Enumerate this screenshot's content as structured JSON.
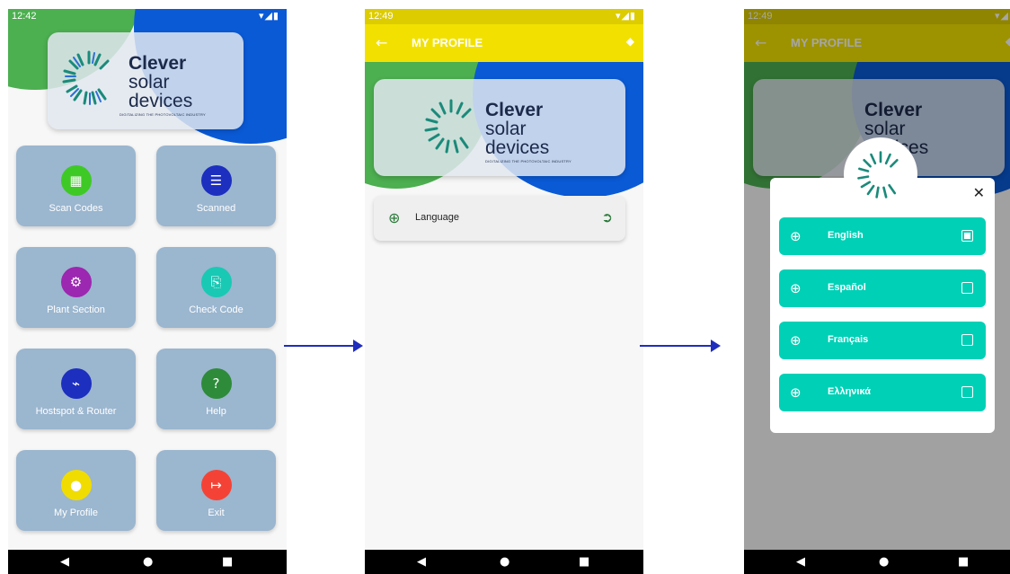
{
  "brand": {
    "line1": "Clever",
    "line2": "solar",
    "line3": "devices",
    "tagline": "DIGITALIZING THE PHOTOVOLTAIC INDUSTRY"
  },
  "colors": {
    "appbar": "#f2e100",
    "tile": "#9bb6cf",
    "accent_teal": "#00d0b6",
    "brand_green": "#4caf50",
    "brand_blue": "#0a5ad6",
    "arrow": "#1f2dbd"
  },
  "screen1": {
    "time": "12:42",
    "status_icons": "▾◢▮",
    "tiles": [
      {
        "label": "Scan Codes",
        "icon": "qr-code-icon",
        "color": "#3fc927",
        "glyph": "▦"
      },
      {
        "label": "Scanned",
        "icon": "list-icon",
        "color": "#1c2fbf",
        "glyph": "☰"
      },
      {
        "label": "Plant Section",
        "icon": "gear-icon",
        "color": "#9c27b0",
        "glyph": "⚙"
      },
      {
        "label": "Check Code",
        "icon": "clipboard-search-icon",
        "color": "#19c9b4",
        "glyph": "⎘"
      },
      {
        "label": "Hostspot & Router",
        "icon": "router-icon",
        "color": "#1c2fbf",
        "glyph": "⌁"
      },
      {
        "label": "Help",
        "icon": "help-icon",
        "color": "#2e8b3a",
        "glyph": "?"
      },
      {
        "label": "My Profile",
        "icon": "person-icon",
        "color": "#f0dc00",
        "glyph": "●"
      },
      {
        "label": "Exit",
        "icon": "exit-icon",
        "color": "#f44336",
        "glyph": "↦"
      }
    ]
  },
  "screen2": {
    "time": "12:49",
    "status_icons": "▾◢▮",
    "title": "MY PROFILE",
    "menu_item": "Language"
  },
  "screen3": {
    "time": "12:49",
    "status_icons": "▾◢▮",
    "title": "MY PROFILE",
    "close_glyph": "✕",
    "languages": [
      {
        "name": "English",
        "selected": true
      },
      {
        "name": "Español",
        "selected": false
      },
      {
        "name": "Français",
        "selected": false
      },
      {
        "name": "Ελληνικά",
        "selected": false
      }
    ]
  },
  "nav": {
    "back": "◀",
    "home": "●",
    "recent": "■"
  }
}
